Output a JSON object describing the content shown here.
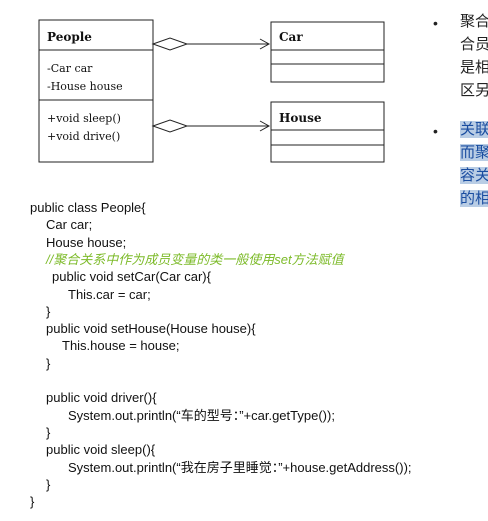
{
  "uml": {
    "people": {
      "name": "People",
      "attrs": [
        "-Car car",
        "-House house"
      ],
      "methods": [
        "+void sleep()",
        "+void drive()"
      ]
    },
    "car": {
      "name": "Car"
    },
    "house": {
      "name": "House"
    }
  },
  "bullets": {
    "b1": [
      "聚合",
      "合员",
      "是相",
      "区另"
    ],
    "b2": [
      "关联",
      "而聚",
      "容关",
      "的相"
    ]
  },
  "code": [
    "public class People{",
    "Car car;",
    "House house;",
    "//聚合关系中作为成员变量的类一般使用set方法赋值",
    "public void setCar(Car car){",
    "This.car = car;",
    "}",
    "public void setHouse(House house){",
    "This.house = house;",
    "}",
    "public void driver(){",
    "System.out.println(“车的型号：”+car.getType());",
    "}",
    "public void sleep(){",
    "System.out.println(“我在房子里睡觉：”+house.getAddress());",
    "}",
    "}"
  ]
}
